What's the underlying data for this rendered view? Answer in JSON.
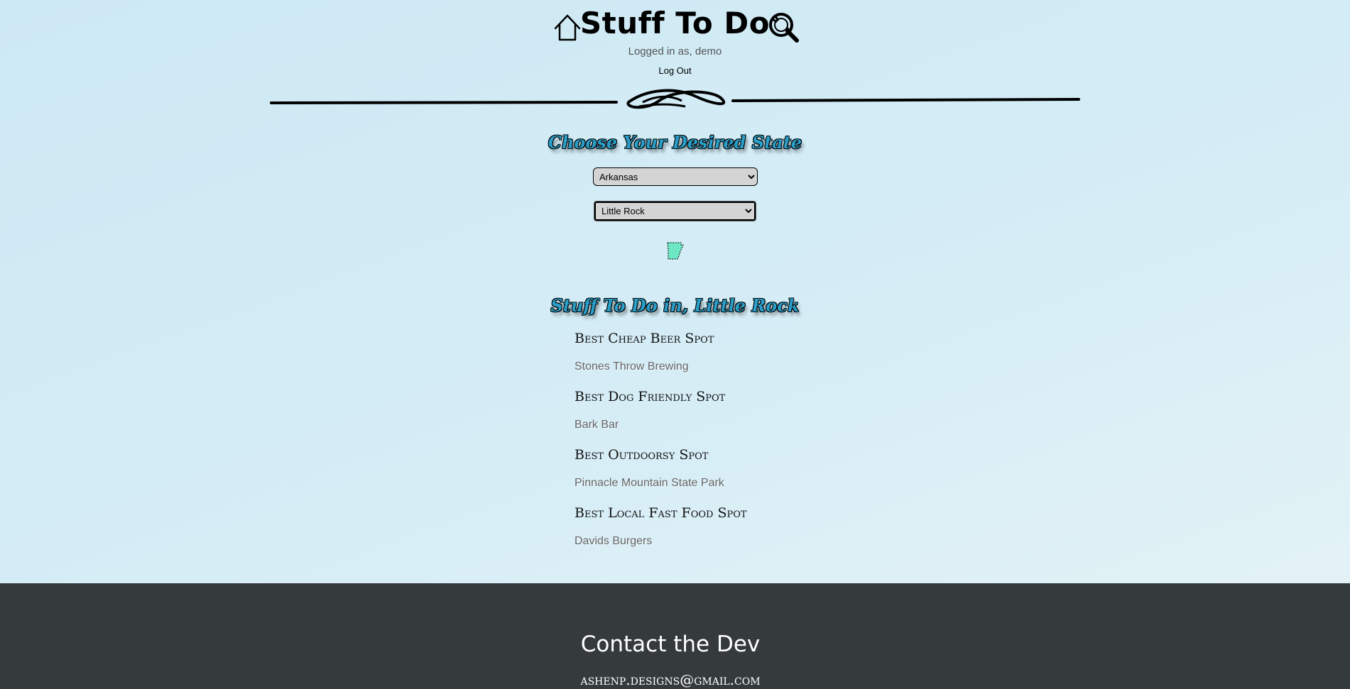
{
  "header": {
    "title": "Stuff To Do",
    "logged_in_text": "Logged in as, demo",
    "logout_label": "Log Out"
  },
  "state_section": {
    "heading": "Choose Your Desired State",
    "state_selected": "Arkansas",
    "city_selected": "Little Rock",
    "state_shape_color": "#6ee8c4"
  },
  "results": {
    "heading": "Stuff To Do in, Little Rock",
    "items": [
      {
        "category": "Best Cheap Beer Spot",
        "place": "Stones Throw Brewing"
      },
      {
        "category": "Best Dog Friendly Spot",
        "place": "Bark Bar"
      },
      {
        "category": "Best Outdoorsy Spot",
        "place": "Pinnacle Mountain State Park"
      },
      {
        "category": "Best Local Fast Food Spot",
        "place": "Davids Burgers"
      }
    ]
  },
  "footer": {
    "title": "Contact the Dev",
    "email": "ashenp.designs@gmail.com"
  },
  "icons": {
    "home": "home-icon",
    "search": "search-icon",
    "divider": "ornament-divider",
    "state": "arkansas-state-outline"
  }
}
